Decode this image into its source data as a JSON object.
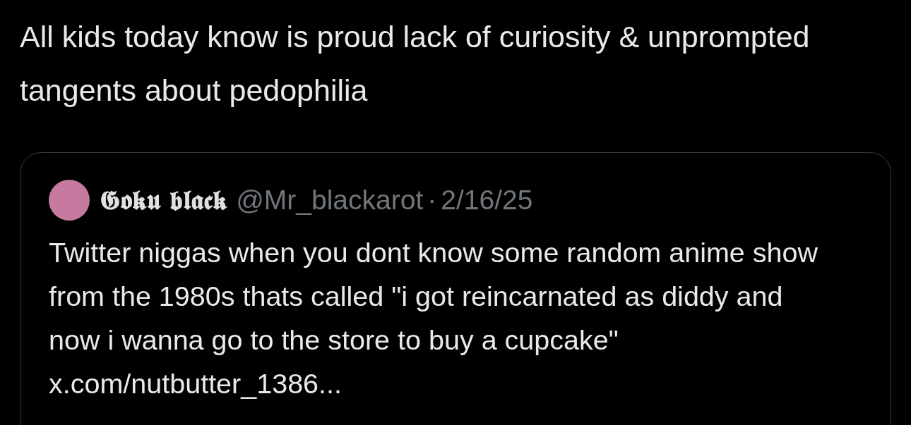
{
  "post": {
    "text": "All kids today know is proud lack of curiosity & unprompted tangents about pedophilia"
  },
  "quoted_post": {
    "display_name": "𝕲𝖔𝖐𝖚 𝖇𝖑𝖆𝖈𝖐",
    "handle": "@Mr_blackarot",
    "separator": "·",
    "date": "2/16/25",
    "text": "Twitter niggas when you dont know some random anime show from the 1980s thats called \"i got reincarnated as diddy and now i wanna go to the store to buy a cupcake\"",
    "link": "x.com/nutbutter_1386..."
  }
}
